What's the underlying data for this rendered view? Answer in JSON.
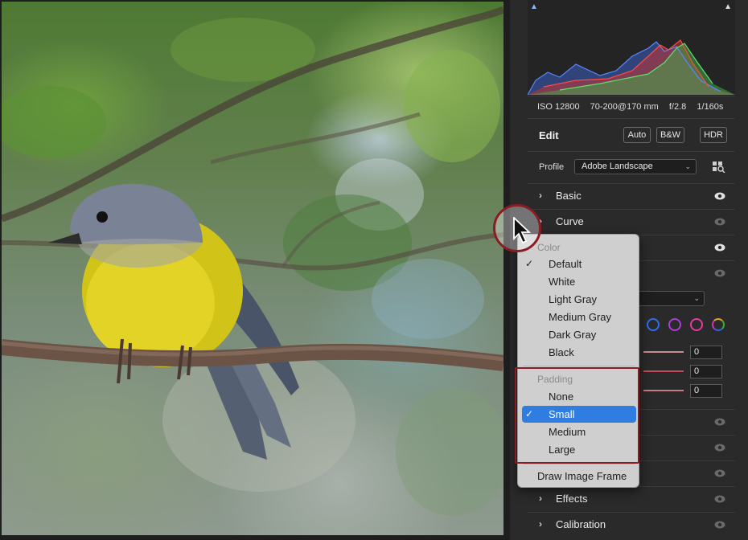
{
  "photo": {
    "subject": "bird-photo"
  },
  "histogram": {
    "left_icon": "shadow-clipping-icon",
    "right_icon": "highlight-clipping-icon"
  },
  "meta": {
    "iso": "ISO 12800",
    "lens": "70-200@170 mm",
    "aperture": "f/2.8",
    "shutter": "1/160s"
  },
  "edit": {
    "title": "Edit",
    "auto_label": "Auto",
    "bw_label": "B&W",
    "hdr_label": "HDR"
  },
  "profile": {
    "label": "Profile",
    "value": "Adobe Landscape"
  },
  "sections": {
    "basic": "Basic",
    "curve": "Curve",
    "effects": "Effects",
    "calibration": "Calibration"
  },
  "sliders": {
    "v1": "0",
    "v2": "0",
    "v3": "0"
  },
  "menu": {
    "color_header": "Color",
    "color_items": [
      "Default",
      "White",
      "Light Gray",
      "Medium Gray",
      "Dark Gray",
      "Black"
    ],
    "color_selected": "Default",
    "padding_header": "Padding",
    "padding_items": [
      "None",
      "Small",
      "Medium",
      "Large"
    ],
    "padding_selected": "Small",
    "frame_item": "Draw Image Frame"
  },
  "colors": {
    "accent_blue": "#2f7de0",
    "highlight_red": "#8c1c24",
    "panel_bg": "#2a2a2a"
  }
}
